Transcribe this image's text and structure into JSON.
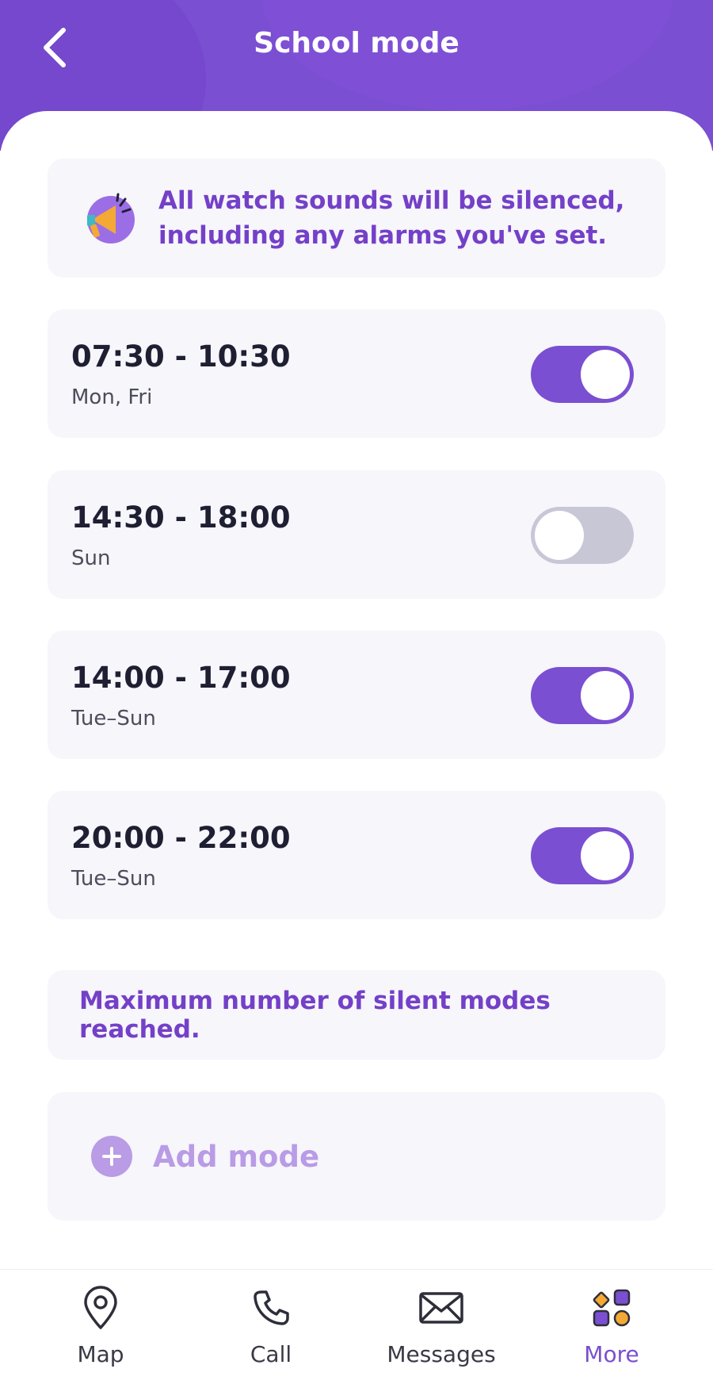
{
  "header": {
    "title": "School mode"
  },
  "info": {
    "text_line1": "All watch sounds will be silenced,",
    "text_line2": "including any alarms you've set."
  },
  "slots": [
    {
      "time": "07:30 - 10:30",
      "days": "Mon, Fri",
      "enabled": true
    },
    {
      "time": "14:30 - 18:00",
      "days": "Sun",
      "enabled": false
    },
    {
      "time": "14:00 - 17:00",
      "days": "Tue–Sun",
      "enabled": true
    },
    {
      "time": "20:00 - 22:00",
      "days": "Tue–Sun",
      "enabled": true
    }
  ],
  "limit": {
    "message": "Maximum number of silent modes reached."
  },
  "add": {
    "label": "Add mode"
  },
  "nav": [
    {
      "label": "Map",
      "icon": "map-pin-icon",
      "active": false
    },
    {
      "label": "Call",
      "icon": "phone-icon",
      "active": false
    },
    {
      "label": "Messages",
      "icon": "envelope-icon",
      "active": false
    },
    {
      "label": "More",
      "icon": "apps-grid-icon",
      "active": true
    }
  ],
  "colors": {
    "primary": "#7a4fd1",
    "toggle_off": "#c8c7d6",
    "card_bg": "#f6f6fb",
    "accent_orange": "#f4a935"
  }
}
